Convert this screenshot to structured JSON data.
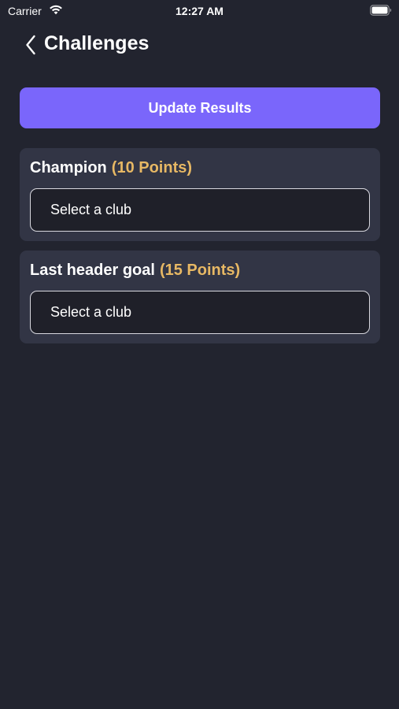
{
  "status_bar": {
    "carrier": "Carrier",
    "time": "12:27 AM"
  },
  "header": {
    "title": "Challenges"
  },
  "actions": {
    "update_label": "Update Results"
  },
  "challenges": [
    {
      "name": "Champion",
      "points": "(10 Points)",
      "select_placeholder": "Select a club"
    },
    {
      "name": "Last header goal",
      "points": "(15 Points)",
      "select_placeholder": "Select a club"
    }
  ],
  "colors": {
    "background": "#22242f",
    "card": "#323545",
    "accent": "#7a66fb",
    "points": "#e7b864"
  },
  "icons": {
    "back": "chevron-left-icon",
    "wifi": "wifi-icon",
    "battery": "battery-icon"
  }
}
